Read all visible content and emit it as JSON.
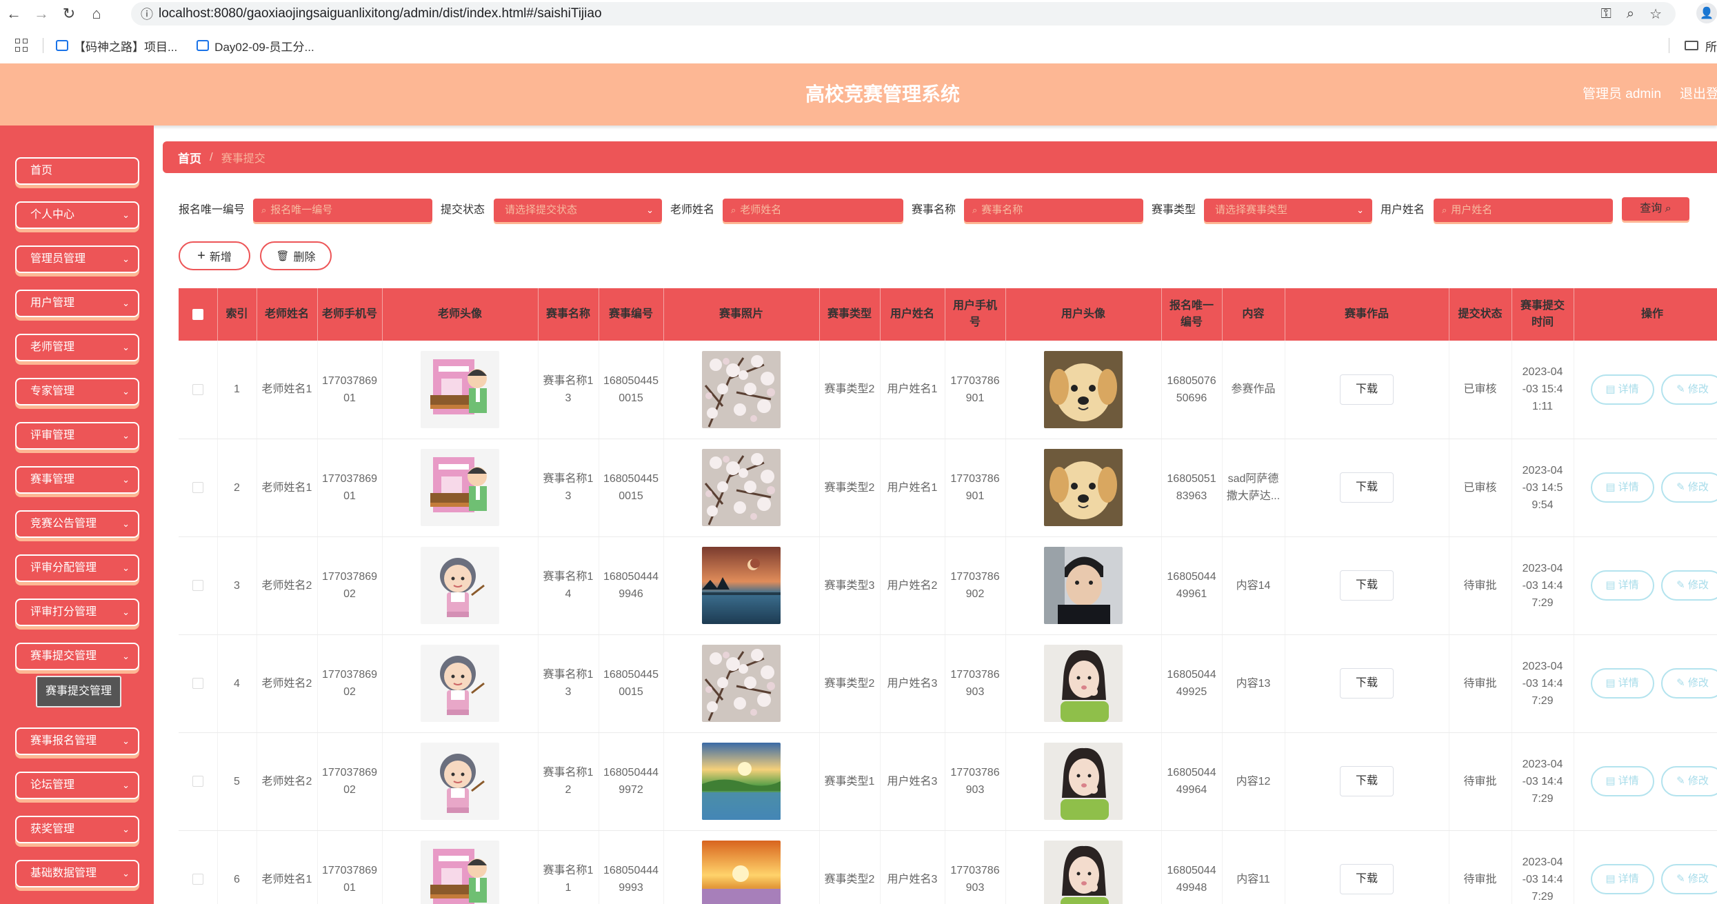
{
  "browser": {
    "url": "localhost:8080/gaoxiaojingsaiguanlixitong/admin/dist/index.html#/saishiTijiao",
    "bookmarks": [
      "【码神之路】项目...",
      "Day02-09-员工分..."
    ],
    "bookmarks_right": "所"
  },
  "header": {
    "title": "高校竞赛管理系统",
    "admin": "管理员 admin",
    "logout": "退出登录"
  },
  "sidebar": {
    "items": [
      {
        "label": "首页",
        "has_arrow": false
      },
      {
        "label": "个人中心",
        "has_arrow": true
      },
      {
        "label": "管理员管理",
        "has_arrow": true
      },
      {
        "label": "用户管理",
        "has_arrow": true
      },
      {
        "label": "老师管理",
        "has_arrow": true
      },
      {
        "label": "专家管理",
        "has_arrow": true
      },
      {
        "label": "评审管理",
        "has_arrow": true
      },
      {
        "label": "赛事管理",
        "has_arrow": true
      },
      {
        "label": "竞赛公告管理",
        "has_arrow": true
      },
      {
        "label": "评审分配管理",
        "has_arrow": true
      },
      {
        "label": "评审打分管理",
        "has_arrow": true
      },
      {
        "label": "赛事提交管理",
        "has_arrow": true
      },
      {
        "label": "赛事报名管理",
        "has_arrow": true
      },
      {
        "label": "论坛管理",
        "has_arrow": true
      },
      {
        "label": "获奖管理",
        "has_arrow": true
      },
      {
        "label": "基础数据管理",
        "has_arrow": true
      }
    ],
    "submenu_active": "赛事提交管理",
    "arrow_glyph": "⌄"
  },
  "breadcrumb": {
    "home": "首页",
    "separator": "/",
    "current": "赛事提交"
  },
  "filters": {
    "labels": [
      "报名唯一编号",
      "提交状态",
      "老师姓名",
      "赛事名称",
      "赛事类型",
      "用户姓名"
    ],
    "placeholders": [
      "报名唯一编号",
      "请选择提交状态",
      "老师姓名",
      "赛事名称",
      "请选择赛事类型",
      "用户姓名"
    ],
    "query": "查询"
  },
  "actions": {
    "add": "新增",
    "delete": "删除"
  },
  "table": {
    "headers": [
      "索引",
      "老师姓名",
      "老师手机号",
      "老师头像",
      "赛事名称",
      "赛事编号",
      "赛事照片",
      "赛事类型",
      "用户姓名",
      "用户手机号",
      "用户头像",
      "报名唯一编号",
      "内容",
      "赛事作品",
      "提交状态",
      "赛事提交时间",
      "操作"
    ],
    "download": "下载",
    "detail": "详情",
    "edit": "修改",
    "rows": [
      {
        "index": "1",
        "teacher": "老师姓名1",
        "teacher_phone": "17703786901",
        "teacher_avatar": "teacher-book",
        "event": "赛事名称13",
        "event_no": "1680504450015",
        "event_photo": "blossom",
        "type": "赛事类型2",
        "user": "用户姓名1",
        "user_phone": "17703786901",
        "user_avatar": "puppy",
        "reg_no": "1680507650696",
        "content": "参赛作品",
        "status": "已审核",
        "time": "2023-04-03 15:41:11"
      },
      {
        "index": "2",
        "teacher": "老师姓名1",
        "teacher_phone": "17703786901",
        "teacher_avatar": "teacher-book",
        "event": "赛事名称13",
        "event_no": "1680504450015",
        "event_photo": "blossom",
        "type": "赛事类型2",
        "user": "用户姓名1",
        "user_phone": "17703786901",
        "user_avatar": "puppy",
        "reg_no": "1680505183963",
        "content": "sad阿萨德撒大萨达...",
        "status": "已审核",
        "time": "2023-04-03 14:59:54"
      },
      {
        "index": "3",
        "teacher": "老师姓名2",
        "teacher_phone": "17703786902",
        "teacher_avatar": "teacher-girl",
        "event": "赛事名称14",
        "event_no": "1680504449946",
        "event_photo": "lake-moon",
        "type": "赛事类型3",
        "user": "用户姓名2",
        "user_phone": "17703786902",
        "user_avatar": "young-man",
        "reg_no": "1680504449961",
        "content": "内容14",
        "status": "待审批",
        "time": "2023-04-03 14:47:29"
      },
      {
        "index": "4",
        "teacher": "老师姓名2",
        "teacher_phone": "17703786902",
        "teacher_avatar": "teacher-girl",
        "event": "赛事名称13",
        "event_no": "1680504450015",
        "event_photo": "blossom",
        "type": "赛事类型2",
        "user": "用户姓名3",
        "user_phone": "17703786903",
        "user_avatar": "young-woman",
        "reg_no": "1680504449925",
        "content": "内容13",
        "status": "待审批",
        "time": "2023-04-03 14:47:29"
      },
      {
        "index": "5",
        "teacher": "老师姓名2",
        "teacher_phone": "17703786902",
        "teacher_avatar": "teacher-girl",
        "event": "赛事名称12",
        "event_no": "1680504449972",
        "event_photo": "sunset-lake",
        "type": "赛事类型1",
        "user": "用户姓名3",
        "user_phone": "17703786903",
        "user_avatar": "young-woman",
        "reg_no": "1680504449964",
        "content": "内容12",
        "status": "待审批",
        "time": "2023-04-03 14:47:29"
      },
      {
        "index": "6",
        "teacher": "老师姓名1",
        "teacher_phone": "17703786901",
        "teacher_avatar": "teacher-book",
        "event": "赛事名称11",
        "event_no": "1680504449993",
        "event_photo": "sunset-field",
        "type": "赛事类型2",
        "user": "用户姓名3",
        "user_phone": "17703786903",
        "user_avatar": "young-woman",
        "reg_no": "1680504449948",
        "content": "内容11",
        "status": "待审批",
        "time": "2023-04-03 14:47:29"
      }
    ]
  },
  "colors": {
    "primary": "#ed5557",
    "accent": "#fdb794",
    "op_border": "#b3e3ee"
  }
}
